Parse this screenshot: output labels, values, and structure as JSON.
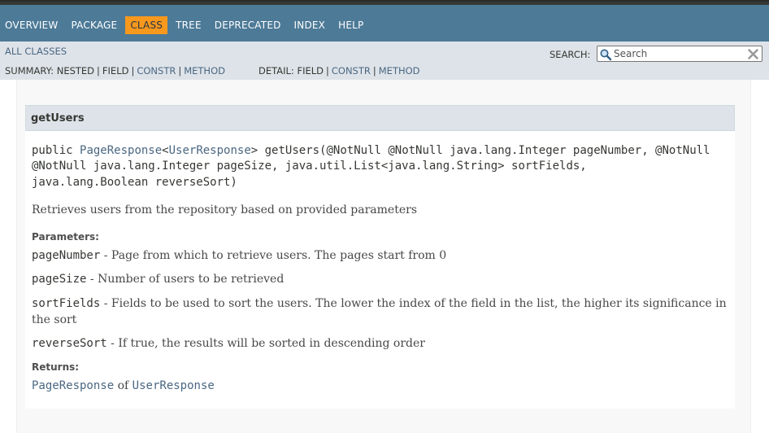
{
  "nav": {
    "items": [
      "OVERVIEW",
      "PACKAGE",
      "CLASS",
      "TREE",
      "DEPRECATED",
      "INDEX",
      "HELP"
    ],
    "active": "CLASS"
  },
  "subnav": {
    "all_classes": "ALL CLASSES",
    "search_label": "SEARCH:",
    "search_placeholder": "Search",
    "summary_label": "SUMMARY:",
    "summary_items": [
      "NESTED",
      "FIELD",
      "CONSTR",
      "METHOD"
    ],
    "detail_label": "DETAIL:",
    "detail_items": [
      "FIELD",
      "CONSTR",
      "METHOD"
    ],
    "separator": "|"
  },
  "method": {
    "name": "getUsers",
    "signature": {
      "line1_prefix": "public ",
      "return_type": "PageResponse",
      "lt": "<",
      "type_arg": "UserResponse",
      "line1_suffix": "> getUsers(@NotNull @NotNull java.lang.Integer pageNumber, @NotNull",
      "line2": "@NotNull java.lang.Integer pageSize, java.util.List<java.lang.String> sortFields,",
      "line3": "java.lang.Boolean reverseSort)"
    },
    "description": "Retrieves users from the repository based on provided parameters",
    "parameters_label": "Parameters:",
    "parameters": [
      {
        "name": "pageNumber",
        "desc": " - Page from which to retrieve users. The pages start from 0"
      },
      {
        "name": "pageSize",
        "desc": " - Number of users to be retrieved"
      },
      {
        "name": "sortFields",
        "desc": " - Fields to be used to sort the users. The lower the index of the field in the list, the higher its significance in the sort"
      },
      {
        "name": "reverseSort",
        "desc": " - If true, the results will be sorted in descending order"
      }
    ],
    "returns_label": "Returns:",
    "returns": {
      "type": "PageResponse",
      "of": " of ",
      "type_arg": "UserResponse"
    }
  },
  "colors": {
    "navbar": "#4d7a97",
    "active_tab": "#f8981d",
    "subnav": "#dee3e9",
    "link": "#4a6782"
  }
}
